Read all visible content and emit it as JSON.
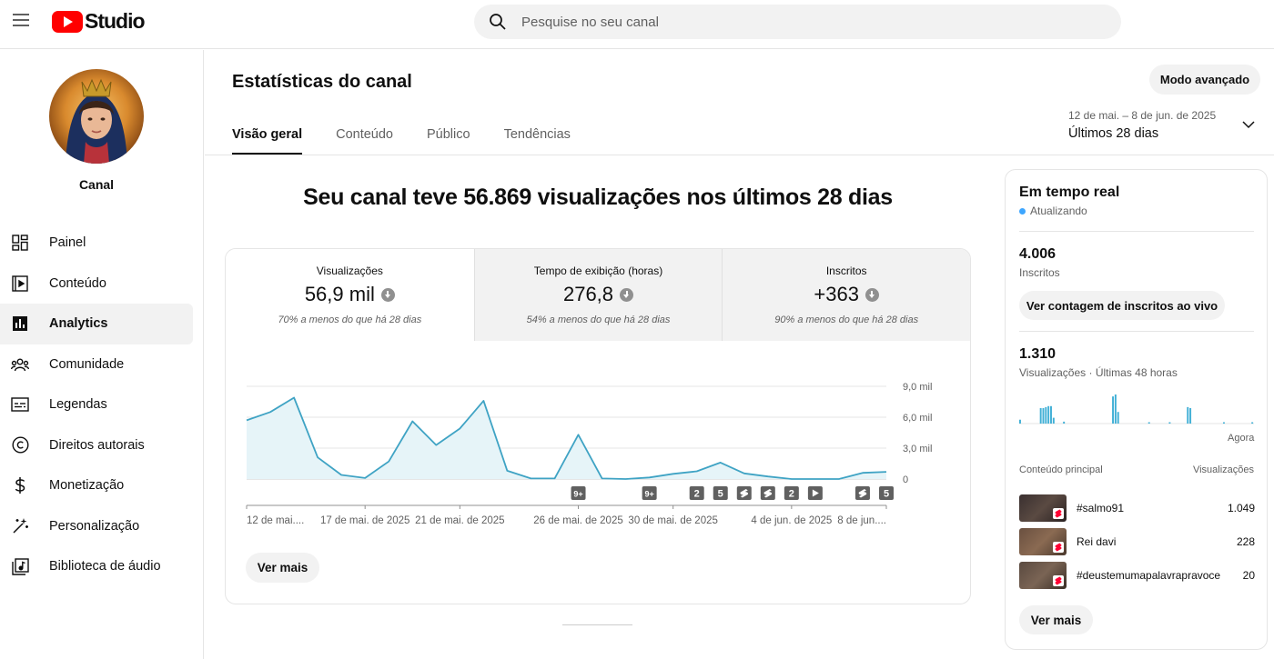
{
  "app": {
    "logo_text": "Studio"
  },
  "search": {
    "placeholder": "Pesquise no seu canal"
  },
  "channel": {
    "name": "Canal"
  },
  "sidebar": {
    "items": [
      {
        "label": "Painel",
        "icon": "dashboard-icon"
      },
      {
        "label": "Conteúdo",
        "icon": "content-icon"
      },
      {
        "label": "Analytics",
        "icon": "analytics-icon",
        "active": true
      },
      {
        "label": "Comunidade",
        "icon": "community-icon"
      },
      {
        "label": "Legendas",
        "icon": "subtitles-icon"
      },
      {
        "label": "Direitos autorais",
        "icon": "copyright-icon"
      },
      {
        "label": "Monetização",
        "icon": "monetization-icon"
      },
      {
        "label": "Personalização",
        "icon": "customization-icon"
      },
      {
        "label": "Biblioteca de áudio",
        "icon": "audio-library-icon"
      }
    ]
  },
  "header": {
    "title": "Estatísticas do canal",
    "advanced_button": "Modo avançado",
    "tabs": [
      "Visão geral",
      "Conteúdo",
      "Público",
      "Tendências"
    ],
    "date_range": {
      "range": "12 de mai. – 8 de jun. de 2025",
      "label": "Últimos 28 dias"
    }
  },
  "overview": {
    "headline": "Seu canal teve 56.869 visualizações nos últimos 28 dias",
    "metrics": [
      {
        "label": "Visualizações",
        "value": "56,9 mil",
        "comparison": "70% a menos do que há 28 dias"
      },
      {
        "label": "Tempo de exibição (horas)",
        "value": "276,8",
        "comparison": "54% a menos do que há 28 dias"
      },
      {
        "label": "Inscritos",
        "value": "+363",
        "comparison": "90% a menos do que há 28 dias"
      }
    ],
    "see_more": "Ver mais"
  },
  "chart_data": {
    "type": "area",
    "series": [
      {
        "values": [
          5700,
          6500,
          7900,
          2100,
          400,
          100,
          1700,
          5600,
          3300,
          4900,
          7600,
          800,
          50,
          50,
          4300,
          50,
          0,
          150,
          500,
          750,
          1600,
          550,
          250,
          0,
          0,
          0,
          600,
          700
        ]
      }
    ],
    "x_labels": [
      "12 de mai....",
      "17 de mai. de 2025",
      "21 de mai. de 2025",
      "26 de mai. de 2025",
      "30 de mai. de 2025",
      "4 de jun. de 2025",
      "8 de jun...."
    ],
    "y_ticks": [
      "0",
      "3,0 mil",
      "6,0 mil",
      "9,0 mil"
    ],
    "ylim": [
      0,
      9000
    ],
    "markers": [
      "9+",
      "9+",
      "2",
      "5",
      "shorts",
      "shorts",
      "2",
      "video",
      "shorts",
      "5"
    ],
    "color": "#3fa3c4"
  },
  "realtime": {
    "title": "Em tempo real",
    "status": "Atualizando",
    "subscribers_value": "4.006",
    "subscribers_label": "Inscritos",
    "live_count_button": "Ver contagem de inscritos ao vivo",
    "views_value": "1.310",
    "views_label": "Visualizações · Últimas 48 horas",
    "now_label": "Agora",
    "bars_48h": [
      4,
      0,
      0,
      0,
      0,
      0,
      0,
      0,
      16,
      16,
      17,
      18,
      18,
      6,
      0,
      0,
      0,
      2,
      0,
      0,
      0,
      0,
      0,
      0,
      0,
      0,
      0,
      0,
      0,
      0,
      0,
      0,
      0,
      0,
      0,
      0,
      28,
      30,
      12,
      0,
      0,
      0,
      0,
      0,
      0,
      0,
      0,
      0,
      0,
      0,
      1,
      0,
      0,
      0,
      0,
      0,
      0,
      0,
      1,
      0,
      0,
      0,
      0,
      0,
      0,
      17,
      16,
      0,
      0,
      0,
      0,
      0,
      0,
      0,
      0,
      0,
      0,
      0,
      0,
      1,
      0,
      0,
      0,
      0,
      0,
      0,
      0,
      0,
      0,
      0,
      1
    ],
    "top_content_header": "Conteúdo principal",
    "top_content_metric": "Visualizações",
    "top_content": [
      {
        "title": "#salmo91",
        "views": "1.049"
      },
      {
        "title": "Rei davi",
        "views": "228"
      },
      {
        "title": "#deustemumapalavrapravoce",
        "views": "20"
      }
    ],
    "see_more": "Ver mais"
  }
}
